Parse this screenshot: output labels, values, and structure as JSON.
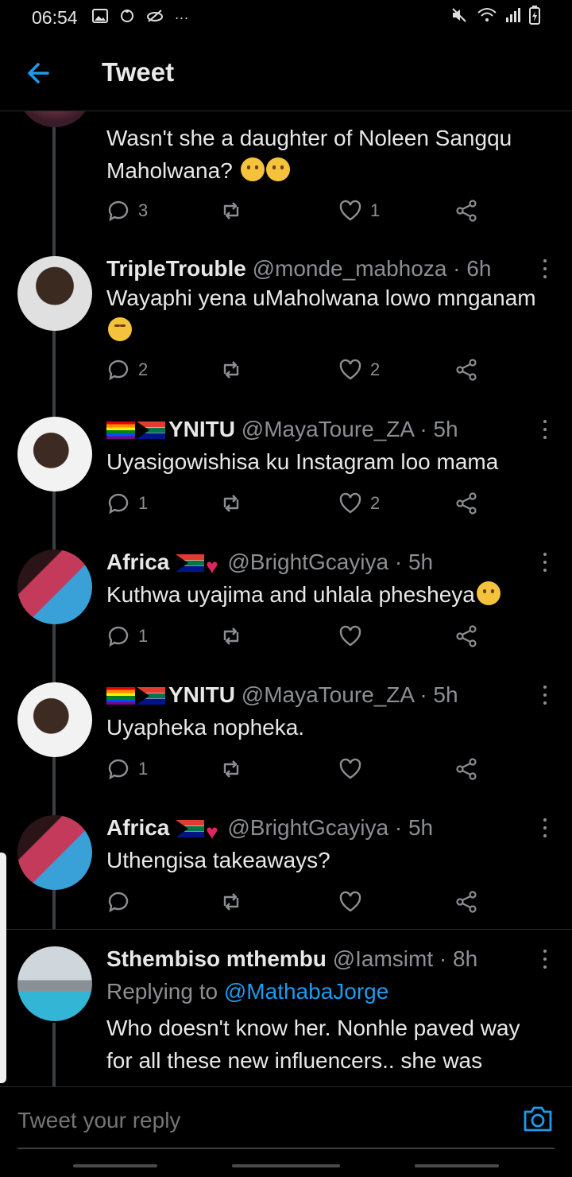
{
  "status_bar": {
    "time": "06:54",
    "overflow": "···"
  },
  "header": {
    "title": "Tweet"
  },
  "tweets": [
    {
      "body": "Wasn't she a daughter of Noleen Sangqu Maholwana?",
      "actions": {
        "replies": "3",
        "retweets": "",
        "likes": "1"
      }
    },
    {
      "name": "TripleTrouble",
      "handle": "@monde_mabhoza",
      "time": "· 6h",
      "body": "Wayaphi yena uMaholwana lowo mnganam",
      "actions": {
        "replies": "2",
        "retweets": "",
        "likes": "2"
      }
    },
    {
      "name": "YNITU",
      "handle": "@MayaToure_ZA",
      "time": "· 5h",
      "body": "Uyasigowishisa ku Instagram loo mama",
      "actions": {
        "replies": "1",
        "retweets": "",
        "likes": "2"
      }
    },
    {
      "name": "Africa",
      "handle": "@BrightGcayiya",
      "time": "· 5h",
      "body": "Kuthwa uyajima and uhlala phesheya",
      "actions": {
        "replies": "1",
        "retweets": "",
        "likes": ""
      }
    },
    {
      "name": "YNITU",
      "handle": "@MayaToure_ZA",
      "time": "· 5h",
      "body": "Uyapheka nopheka.",
      "actions": {
        "replies": "1",
        "retweets": "",
        "likes": ""
      }
    },
    {
      "name": "Africa",
      "handle": "@BrightGcayiya",
      "time": "· 5h",
      "body": "Uthengisa takeaways?",
      "actions": {
        "replies": "",
        "retweets": "",
        "likes": ""
      }
    },
    {
      "name": "Sthembiso mthembu",
      "handle": "@Iamsimt",
      "time": "· 8h",
      "replying_prefix": "Replying to",
      "replying_to": "@MathabaJorge",
      "body": "Who doesn't know her. Nonhle paved way for all these new influencers.. she was"
    }
  ],
  "reply_bar": {
    "placeholder": "Tweet your reply"
  },
  "colors": {
    "accent": "#1d9bf0",
    "background": "#000000",
    "muted": "#8b8f94"
  }
}
